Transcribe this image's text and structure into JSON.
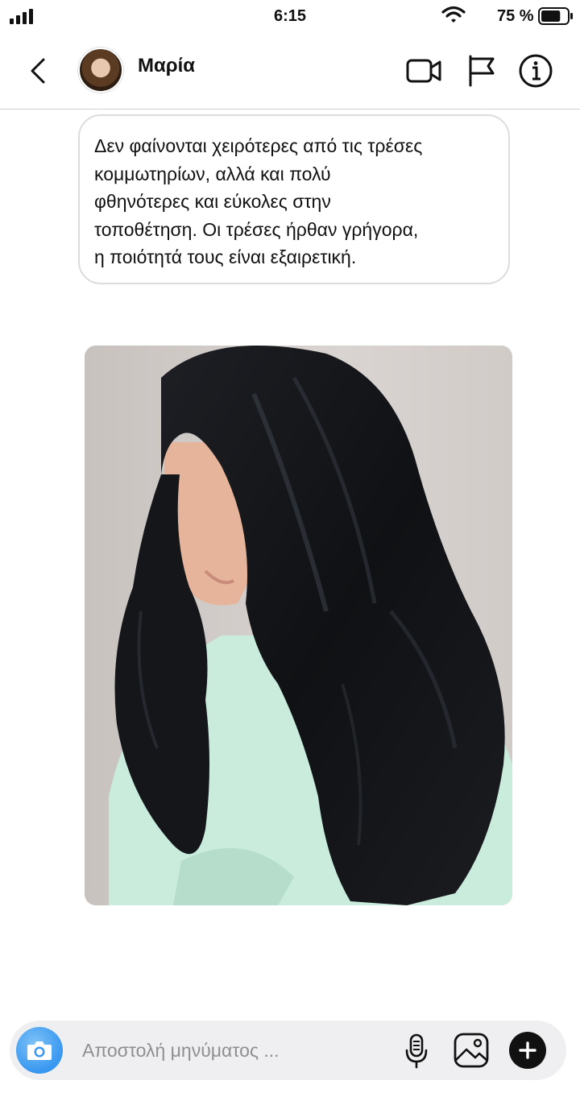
{
  "status_bar": {
    "time": "6:15",
    "battery_percent": "75 %",
    "signal_icon": "cellular-signal-icon",
    "wifi_icon": "wifi-icon",
    "battery_icon": "battery-icon",
    "battery_level": 0.75
  },
  "header": {
    "back_icon": "chevron-left-icon",
    "contact_name": "Μαρία",
    "video_icon": "video-camera-icon",
    "flag_icon": "flag-icon",
    "info_icon": "info-icon"
  },
  "conversation": {
    "messages": [
      {
        "type": "text",
        "text": "Δεν φαίνονται χειρότερες από τις τρέσες\nκομμωτηρίων, αλλά και πολύ\nφθηνότερες και εύκολες στην\nτοποθέτηση. Οι τρέσες ήρθαν γρήγορα,\nη ποιότητά τους είναι εξαιρετική."
      },
      {
        "type": "image",
        "image_icon": "photo-woman-long-black-hair"
      }
    ]
  },
  "composer": {
    "placeholder": "Αποστολή μηνύματος ...",
    "value": "",
    "camera_icon": "camera-icon",
    "mic_icon": "microphone-icon",
    "gallery_icon": "image-gallery-icon",
    "add_icon": "plus-icon"
  },
  "colors": {
    "accent_blue": "#3897f0",
    "bubble_border": "#dcdcdc",
    "composer_bg": "#efeff1"
  }
}
